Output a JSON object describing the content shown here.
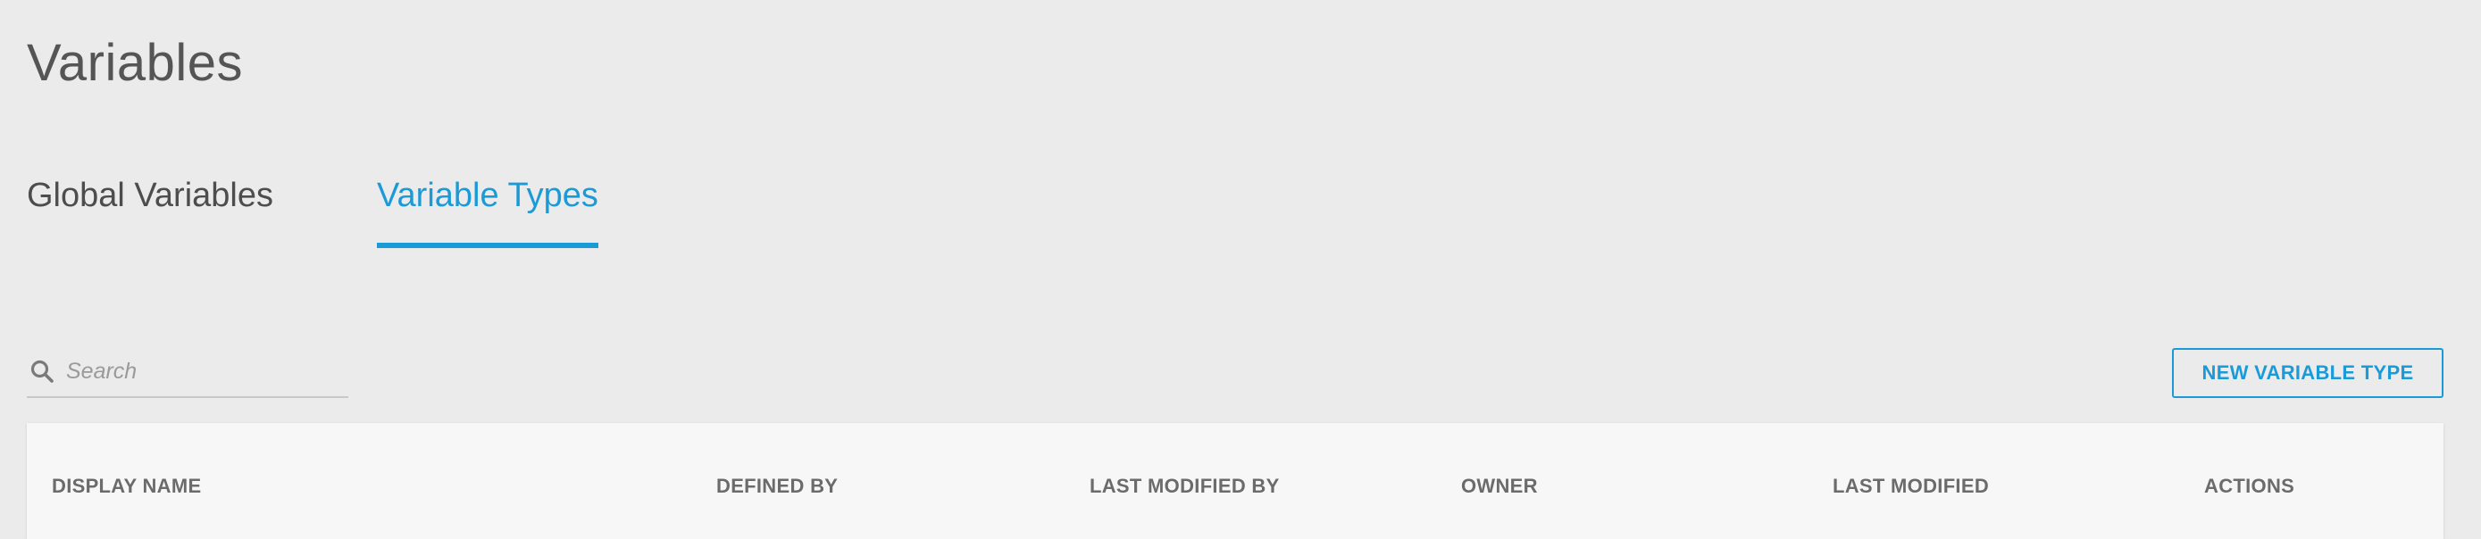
{
  "page": {
    "title": "Variables"
  },
  "tabs": [
    {
      "label": "Global Variables",
      "active": false
    },
    {
      "label": "Variable Types",
      "active": true
    }
  ],
  "search": {
    "placeholder": "Search",
    "value": "",
    "icon": "search-icon"
  },
  "toolbar": {
    "new_button_label": "NEW VARIABLE TYPE"
  },
  "table": {
    "columns": [
      "DISPLAY NAME",
      "DEFINED BY",
      "LAST MODIFIED BY",
      "OWNER",
      "LAST MODIFIED",
      "ACTIONS"
    ],
    "rows": []
  },
  "colors": {
    "accent": "#1a9bd7",
    "background": "#ebebeb",
    "table_background": "#f7f7f7"
  }
}
